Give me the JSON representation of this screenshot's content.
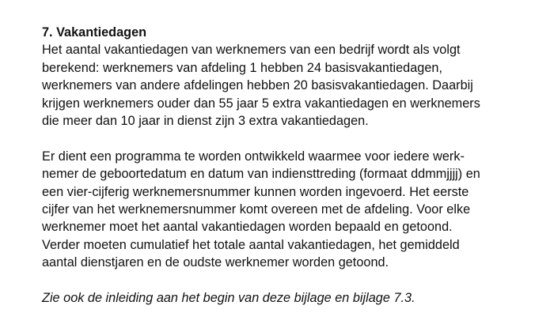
{
  "heading": "7. Vakantiedagen",
  "paragraph1": [
    "Het aantal vakantiedagen van werknemers van een bedrijf wordt als volgt",
    "berekend: werknemers van afdeling 1 hebben 24 basisvakantiedagen,",
    "werknemers van andere afdelingen hebben 20 basisvakantiedagen. Daarbij",
    "krijgen werknemers ouder dan 55 jaar 5 extra vakantiedagen en werknemers",
    "die meer dan 10 jaar in dienst zijn 3 extra vakantiedagen."
  ],
  "paragraph2": [
    "Er dient een programma te worden ontwikkeld waarmee voor iedere werk-",
    "nemer de geboortedatum en datum van indiensttreding (formaat ddmmjjjj) en",
    "een vier-cijferig werknemersnummer kunnen worden ingevoerd. Het eerste",
    "cijfer van het werknemersnummer komt overeen met de afdeling. Voor elke",
    "werknemer moet het aantal vakantiedagen worden bepaald en getoond.",
    "Verder moeten cumulatief het totale aantal vakantiedagen, het gemiddeld",
    "aantal dienstjaren en de oudste werknemer worden getoond."
  ],
  "note": "Zie ook de inleiding aan het begin van deze bijlage en bijlage 7.3."
}
